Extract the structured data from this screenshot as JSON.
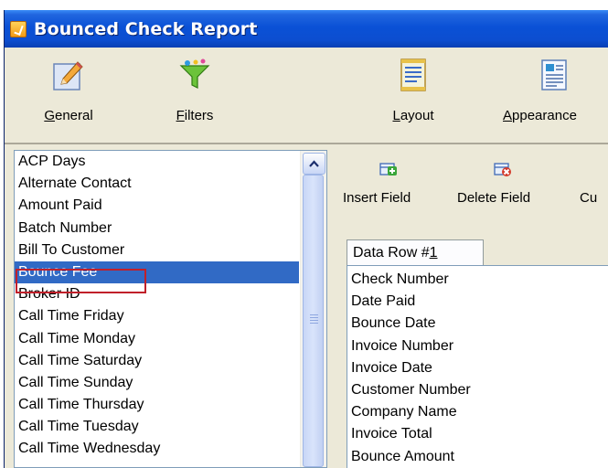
{
  "window": {
    "title": "Bounced Check Report"
  },
  "toolbar": {
    "buttons": [
      {
        "underline": "G",
        "rest": "eneral",
        "icon": "pencil-icon"
      },
      {
        "underline": "F",
        "rest": "ilters",
        "icon": "funnel-icon"
      },
      {
        "underline": "L",
        "rest": "ayout",
        "icon": "layout-icon"
      },
      {
        "underline": "A",
        "rest": "ppearance",
        "icon": "appearance-icon"
      }
    ]
  },
  "field_list": {
    "items": [
      "ACP Days",
      "Alternate Contact",
      "Amount Paid",
      "Batch Number",
      "Bill To Customer",
      "Bounce Fee",
      "Broker ID",
      "Call Time Friday",
      "Call Time Monday",
      "Call Time Saturday",
      "Call Time Sunday",
      "Call Time Thursday",
      "Call Time Tuesday",
      "Call Time Wednesday"
    ],
    "selected_index": 5
  },
  "actions": {
    "insert_label": "Insert Field",
    "delete_label": "Delete Field",
    "cut_label": "Cu"
  },
  "data_row": {
    "tab_prefix": "Data Row #",
    "tab_number": "1",
    "fields": [
      "Check Number",
      "Date Paid",
      "Bounce Date",
      "Invoice Number",
      "Invoice Date",
      "Customer Number",
      "Company Name",
      "Invoice Total",
      "Bounce Amount"
    ]
  },
  "colors": {
    "titlebar": "#0a51d6",
    "selection": "#316ac5",
    "callout": "#c0202a",
    "window_bg": "#ece9d8"
  }
}
